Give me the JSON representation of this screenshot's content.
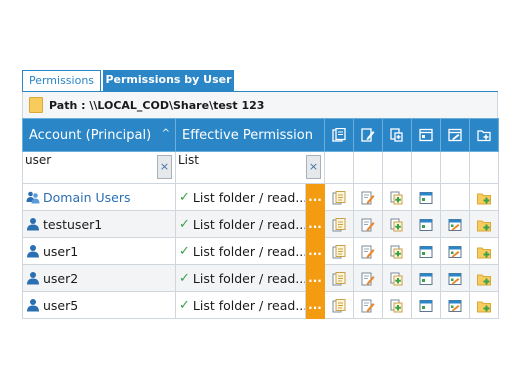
{
  "tabs": [
    {
      "label": "Permissions"
    },
    {
      "label": "Permissions by User"
    }
  ],
  "path": {
    "label": "Path : \\\\LOCAL_COD\\Share\\test 123"
  },
  "grid": {
    "col_account": "Account (Principal)",
    "col_effective": "Effective Permission",
    "sort_indicator": "^",
    "filter_account": "user",
    "filter_effective": "List",
    "clear_glyph": "×",
    "more_glyph": "...",
    "check_glyph": "✓",
    "rows": [
      {
        "account": "Domain Users",
        "type": "group",
        "permission": "List folder / read...",
        "icons": [
          "read-data",
          "write",
          "add-sub",
          "list-view",
          "",
          "folder-add"
        ]
      },
      {
        "account": "testuser1",
        "type": "user",
        "permission": "List folder / read...",
        "icons": [
          "read-data",
          "write",
          "add-sub",
          "list-view",
          "edit-view",
          "folder-add"
        ]
      },
      {
        "account": "user1",
        "type": "user",
        "permission": "List folder / read...",
        "icons": [
          "read-data",
          "write",
          "add-sub",
          "list-view",
          "edit-view",
          "folder-add"
        ]
      },
      {
        "account": "user2",
        "type": "user",
        "permission": "List folder / read...",
        "icons": [
          "read-data",
          "write",
          "add-sub",
          "list-view",
          "edit-view",
          "folder-add"
        ]
      },
      {
        "account": "user5",
        "type": "user",
        "permission": "List folder / read...",
        "icons": [
          "read-data",
          "write",
          "add-sub",
          "list-view",
          "edit-view",
          "folder-add"
        ]
      }
    ]
  },
  "colors": {
    "accent": "#2b86c8",
    "more": "#f39c12",
    "check": "#3aa14a"
  }
}
